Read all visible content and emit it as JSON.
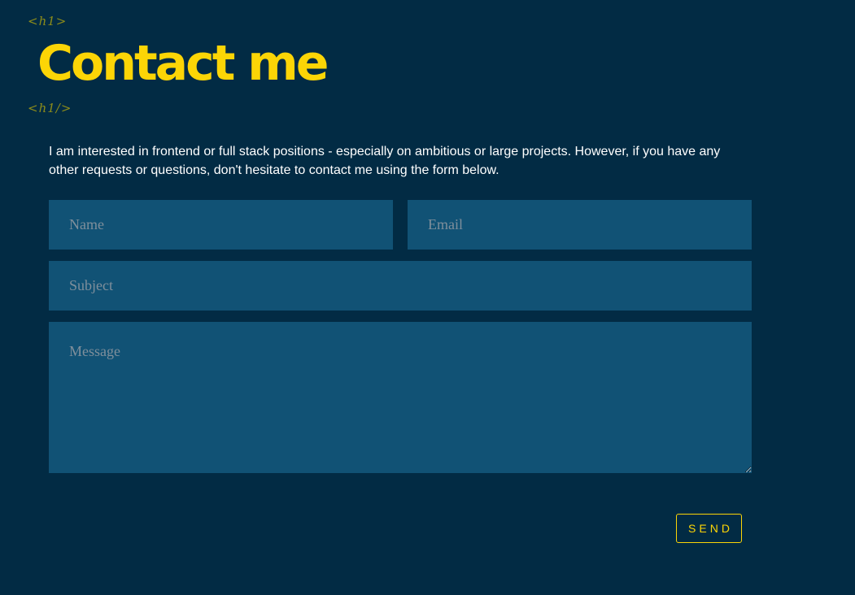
{
  "header": {
    "tag_open": "<h1>",
    "title": "Contact me",
    "tag_close": "<h1/>"
  },
  "intro": {
    "text": "I am interested in frontend or full stack positions - especially on ambitious or large projects. However, if you have any other requests or questions, don't hesitate to contact me using the form below."
  },
  "form": {
    "name": {
      "placeholder": "Name",
      "value": ""
    },
    "email": {
      "placeholder": "Email",
      "value": ""
    },
    "subject": {
      "placeholder": "Subject",
      "value": ""
    },
    "message": {
      "placeholder": "Message",
      "value": ""
    },
    "send_label": "SEND"
  },
  "colors": {
    "background": "#022b44",
    "field_background": "#115275",
    "accent": "#fcd506",
    "tag": "#8e8d1a"
  }
}
